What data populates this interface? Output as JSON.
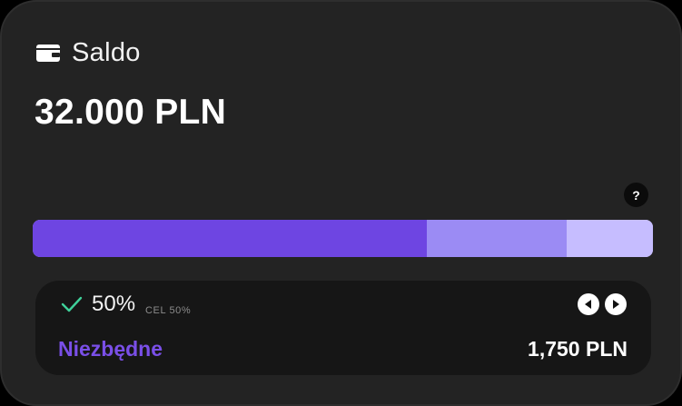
{
  "header": {
    "title": "Saldo",
    "icon": "wallet-icon"
  },
  "balance": "32.000 PLN",
  "help": {
    "label": "?",
    "icon": "help-icon"
  },
  "progress": {
    "segments": [
      {
        "name": "segment-1",
        "fraction": 0.636,
        "color": "#6e45e2"
      },
      {
        "name": "segment-2",
        "fraction": 0.225,
        "color": "#9b8bf4"
      },
      {
        "name": "segment-3",
        "fraction": 0.139,
        "color": "#c6bdff"
      }
    ]
  },
  "detail": {
    "check_icon": "check-icon",
    "percent": "50%",
    "goal_label": "CEL 50%",
    "category": "Niezbędne",
    "amount": "1,750 PLN",
    "prev_icon": "chevron-left-icon",
    "next_icon": "chevron-right-icon"
  },
  "colors": {
    "card_background": "#232323",
    "detail_background": "#161616",
    "accent": "#6e45e2",
    "category_text": "#7a4fe8",
    "check": "#3fd19a"
  }
}
